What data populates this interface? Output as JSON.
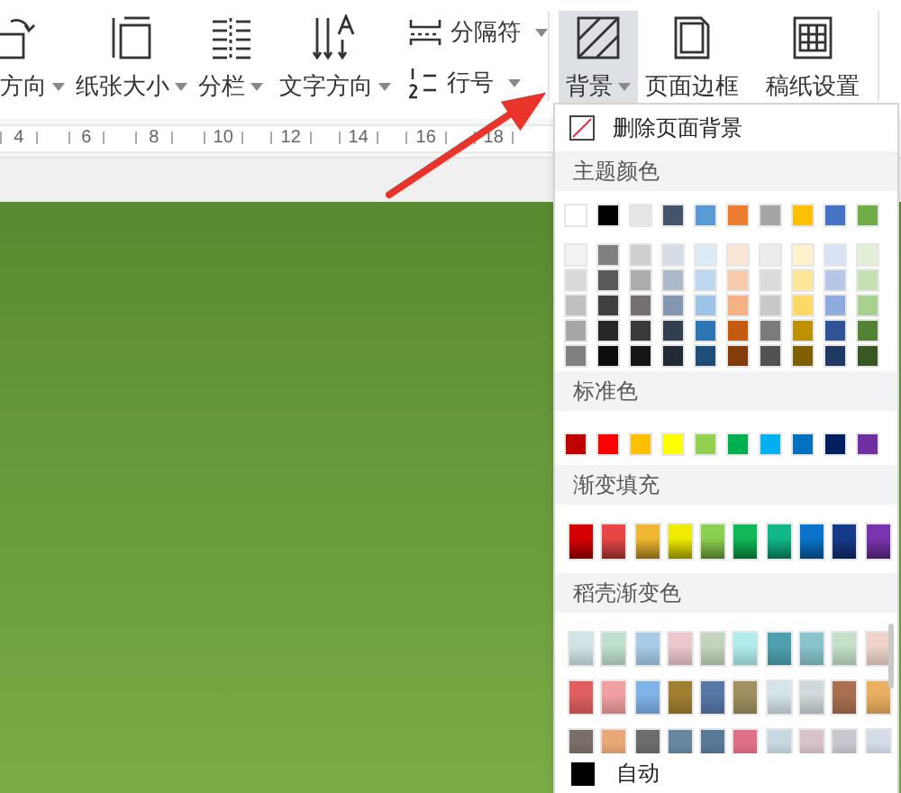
{
  "toolbar": {
    "items": [
      {
        "kind": "large",
        "label": "方向",
        "dropdown": true,
        "selected": false
      },
      {
        "kind": "large",
        "label": "纸张大小",
        "dropdown": true,
        "selected": false
      },
      {
        "kind": "large",
        "label": "分栏",
        "dropdown": true,
        "selected": false
      },
      {
        "kind": "large",
        "label": "文字方向",
        "dropdown": true,
        "selected": false
      },
      {
        "kind": "stacked",
        "rows": [
          {
            "label": "分隔符",
            "dropdown": true
          },
          {
            "label": "行号",
            "dropdown": true
          }
        ]
      },
      {
        "kind": "large",
        "label": "背景",
        "dropdown": true,
        "selected": true
      },
      {
        "kind": "large",
        "label": "页面边框",
        "dropdown": false,
        "selected": false
      },
      {
        "kind": "large",
        "label": "稿纸设置",
        "dropdown": false,
        "selected": false
      }
    ]
  },
  "ruler": {
    "labels": [
      "4",
      "6",
      "8",
      "10",
      "12",
      "14",
      "16",
      "18"
    ]
  },
  "background_menu": {
    "remove": {
      "label": "删除页面背景"
    },
    "sections": [
      {
        "title": "主题颜色",
        "kind": "theme",
        "rows": [
          [
            {
              "color": "#ffffff"
            },
            {
              "color": "#000000"
            },
            {
              "color": "#e7e6e6"
            },
            {
              "color": "#44546a"
            },
            {
              "color": "#5b9bd5"
            },
            {
              "color": "#ed7d31"
            },
            {
              "color": "#a5a5a5"
            },
            {
              "color": "#ffc000"
            },
            {
              "color": "#4472c4"
            },
            {
              "color": "#70ad47"
            }
          ],
          [
            {
              "color": "#f2f2f2"
            },
            {
              "color": "#808080"
            },
            {
              "color": "#d0cece"
            },
            {
              "color": "#d6dce5"
            },
            {
              "color": "#deebf7"
            },
            {
              "color": "#fbe5d6"
            },
            {
              "color": "#ededed"
            },
            {
              "color": "#fff2cc"
            },
            {
              "color": "#dae3f3"
            },
            {
              "color": "#e2f0d9"
            }
          ],
          [
            {
              "color": "#d9d9d9"
            },
            {
              "color": "#595959"
            },
            {
              "color": "#aeabab"
            },
            {
              "color": "#adb9ca"
            },
            {
              "color": "#bdd7ee"
            },
            {
              "color": "#f8cbad"
            },
            {
              "color": "#dbdbdb"
            },
            {
              "color": "#ffe699"
            },
            {
              "color": "#b4c7e7"
            },
            {
              "color": "#c5e0b4"
            }
          ],
          [
            {
              "color": "#bfbfbf"
            },
            {
              "color": "#404040"
            },
            {
              "color": "#757070"
            },
            {
              "color": "#8497b0"
            },
            {
              "color": "#9dc3e6"
            },
            {
              "color": "#f4b183"
            },
            {
              "color": "#c9c9c9"
            },
            {
              "color": "#ffd966"
            },
            {
              "color": "#8faadc"
            },
            {
              "color": "#a9d18e"
            }
          ],
          [
            {
              "color": "#a6a6a6"
            },
            {
              "color": "#262626"
            },
            {
              "color": "#3a3838"
            },
            {
              "color": "#333f50"
            },
            {
              "color": "#2e75b6"
            },
            {
              "color": "#c55a11"
            },
            {
              "color": "#7b7b7b"
            },
            {
              "color": "#bf9000"
            },
            {
              "color": "#2f5597"
            },
            {
              "color": "#548235"
            }
          ],
          [
            {
              "color": "#808080"
            },
            {
              "color": "#0d0d0d"
            },
            {
              "color": "#171616"
            },
            {
              "color": "#222a35"
            },
            {
              "color": "#1f4e79"
            },
            {
              "color": "#843c0c"
            },
            {
              "color": "#525252"
            },
            {
              "color": "#7f6000"
            },
            {
              "color": "#203864"
            },
            {
              "color": "#385723"
            }
          ]
        ]
      },
      {
        "title": "标准色",
        "kind": "standard",
        "rows": [
          [
            {
              "color": "#c00000"
            },
            {
              "color": "#ff0000"
            },
            {
              "color": "#ffc000"
            },
            {
              "color": "#ffff00"
            },
            {
              "color": "#92d050"
            },
            {
              "color": "#00b050"
            },
            {
              "color": "#00b0f0"
            },
            {
              "color": "#0070c0"
            },
            {
              "color": "#002060"
            },
            {
              "color": "#7030a0"
            }
          ]
        ]
      },
      {
        "title": "渐变填充",
        "kind": "gradient",
        "rows": [
          [
            {
              "color": "#d40000"
            },
            {
              "color": "#e84646"
            },
            {
              "color": "#f0b830"
            },
            {
              "color": "#f0ec00"
            },
            {
              "color": "#8cd050"
            },
            {
              "color": "#10b858"
            },
            {
              "color": "#10b888"
            },
            {
              "color": "#0a74cc"
            },
            {
              "color": "#163a8a"
            },
            {
              "color": "#7a34b0"
            }
          ]
        ]
      },
      {
        "title": "稻壳渐变色",
        "kind": "daoke",
        "rows": [
          [
            {
              "color": "#d0e4e8"
            },
            {
              "color": "#bfe0cc"
            },
            {
              "color": "#a8cce8"
            },
            {
              "color": "#ecc8cc"
            },
            {
              "color": "#c4d4bc"
            },
            {
              "color": "#b0ecec"
            },
            {
              "color": "#4ea0b0"
            },
            {
              "color": "#88c4cc"
            },
            {
              "color": "#c4e0c8"
            },
            {
              "color": "#f0d4cc"
            }
          ],
          [
            {
              "color": "#e06060"
            },
            {
              "color": "#f0a0a0"
            },
            {
              "color": "#80b4e8"
            },
            {
              "color": "#a08030"
            },
            {
              "color": "#5878a8"
            },
            {
              "color": "#a09060"
            },
            {
              "color": "#d4e4e8"
            },
            {
              "color": "#d0d8dc"
            },
            {
              "color": "#a87050"
            },
            {
              "color": "#e8b060"
            }
          ],
          [
            {
              "color": "#7a6e68"
            },
            {
              "color": "#e8a878"
            },
            {
              "color": "#6c6c6c"
            },
            {
              "color": "#6888a0"
            },
            {
              "color": "#5a7898"
            },
            {
              "color": "#e07088"
            },
            {
              "color": "#c8d8e0"
            },
            {
              "color": "#d8c4c8"
            },
            {
              "color": "#c8c8d0"
            },
            {
              "color": "#d4dce8"
            }
          ]
        ]
      }
    ],
    "auto": {
      "label": "自动",
      "color": "#000000"
    }
  }
}
